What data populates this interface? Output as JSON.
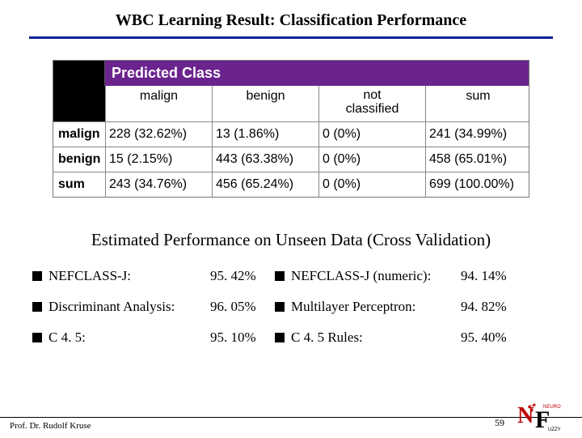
{
  "title": "WBC Learning Result: Classification Performance",
  "table": {
    "header_label": "Predicted Class",
    "columns": [
      "malign",
      "benign",
      "not\nclassified",
      "sum"
    ],
    "rows": [
      {
        "label": "malign",
        "cells": [
          "228 (32.62%)",
          "13   (1.86%)",
          "0     (0%)",
          "241  (34.99%)"
        ]
      },
      {
        "label": "benign",
        "cells": [
          "15   (2.15%)",
          "443 (63.38%)",
          "0     (0%)",
          "458  (65.01%)"
        ]
      },
      {
        "label": "sum",
        "cells": [
          "243 (34.76%)",
          "456 (65.24%)",
          "0     (0%)",
          "699 (100.00%)"
        ]
      }
    ]
  },
  "subheading": "Estimated Performance on Unseen Data (Cross Validation)",
  "methods": [
    {
      "name": "NEFCLASS-J:",
      "value": "95. 42%"
    },
    {
      "name": "NEFCLASS-J (numeric):",
      "value": "94. 14%"
    },
    {
      "name": "Discriminant Analysis:",
      "value": "96. 05%"
    },
    {
      "name": "Multilayer Perceptron:",
      "value": "94. 82%"
    },
    {
      "name": "C 4. 5:",
      "value": "95. 10%"
    },
    {
      "name": "C 4. 5 Rules:",
      "value": "95. 40%"
    }
  ],
  "footer": {
    "author": "Prof. Dr. Rudolf Kruse",
    "page": "59",
    "logo_label": "NF Neuro Fuzzy"
  },
  "chart_data": {
    "type": "table",
    "title": "Confusion Matrix (counts and percentages of 699 samples)",
    "row_labels": [
      "malign",
      "benign",
      "sum"
    ],
    "col_labels": [
      "malign",
      "benign",
      "not classified",
      "sum"
    ],
    "values": [
      [
        228,
        13,
        0,
        241
      ],
      [
        15,
        443,
        0,
        458
      ],
      [
        243,
        456,
        0,
        699
      ]
    ],
    "percentages": [
      [
        32.62,
        1.86,
        0,
        34.99
      ],
      [
        2.15,
        63.38,
        0,
        65.01
      ],
      [
        34.76,
        65.24,
        0,
        100.0
      ]
    ]
  }
}
